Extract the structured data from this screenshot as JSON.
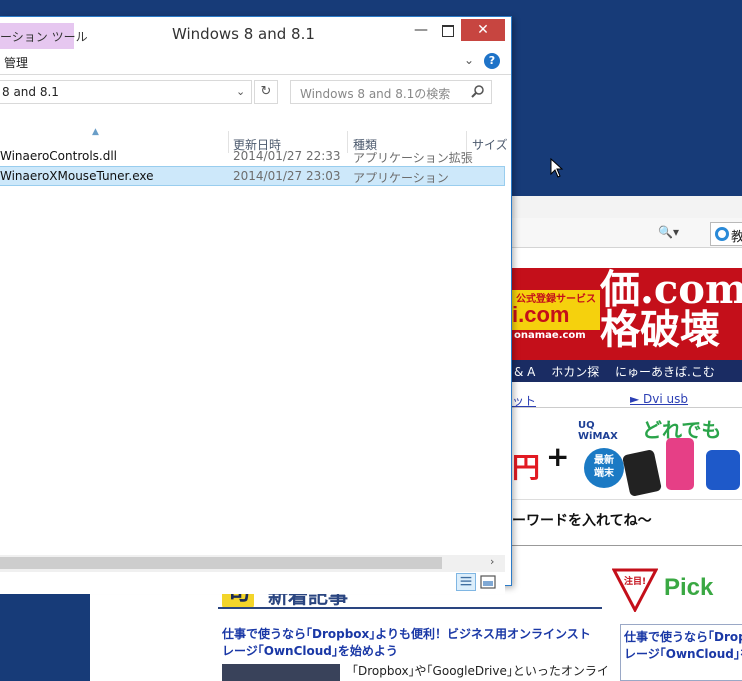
{
  "explorer": {
    "context_tab": "ーション ツール",
    "title": "Windows 8 and 8.1",
    "ribbon_manage": "管理",
    "address": "8 and 8.1",
    "search_placeholder": "Windows 8 and 8.1の検索",
    "columns": {
      "modified": "更新日時",
      "type": "種類",
      "size": "サイズ"
    },
    "files": [
      {
        "name": "WinaeroControls.dll",
        "modified": "2014/01/27 22:33",
        "type": "アプリケーション拡張",
        "selected": false
      },
      {
        "name": "WinaeroXMouseTuner.exe",
        "modified": "2014/01/27 23:03",
        "type": "アプリケーション",
        "selected": true
      }
    ]
  },
  "browser": {
    "ie_tab_text": "教",
    "banner": {
      "badge": "公式登録サービス",
      "com_text": "i.com",
      "domain": "onamae.com",
      "big_text": "価.com\n格破壊"
    },
    "nav_text": "& A　 ホカン探　 にゅーあきば.こむ",
    "link_left": "ット",
    "link_right": "► Dvi usb",
    "ad": {
      "red_text": "円",
      "plus": "+",
      "uq": "UQ WiMAX",
      "circle": "最新\n端末",
      "dore": "どれでも"
    },
    "keyword_text": "ーワードを入れてね～",
    "section_title": "新着記事",
    "section_icon_char": "旬",
    "pick_label": "Pick",
    "pick_badge": "注目!",
    "article_title": "仕事で使うなら｢Dropbox｣よりも便利！ビジネス用オンラインストレージ｢OwnCloud｣を始めよう",
    "article_body": "｢Dropbox｣や｢GoogleDrive｣といったオンライ",
    "right_article": "仕事で使うなら｢Drop\nレージ｢OwnCloud｣を"
  },
  "colors": {
    "desktop": "#173b78",
    "close_button": "#c74540",
    "selection": "#cde8fa",
    "context_tab": "#e6c7f0",
    "banner_red": "#c40f1a",
    "banner_yellow": "#f5d10d"
  }
}
